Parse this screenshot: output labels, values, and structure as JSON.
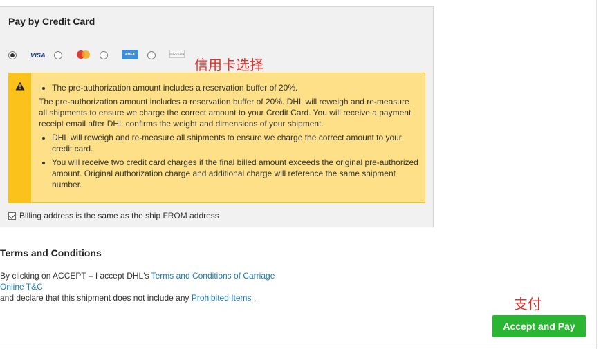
{
  "panel": {
    "title": "Pay by Credit Card",
    "cards": [
      {
        "name": "VISA",
        "selected": true
      },
      {
        "name": "MasterCard",
        "selected": false
      },
      {
        "name": "AMERICAN EXPRESS",
        "selected": false
      },
      {
        "name": "DISCOVER",
        "selected": false
      }
    ]
  },
  "annotations": {
    "card_select": "信用卡选择",
    "pay": "支付"
  },
  "warning": {
    "bullet_1": "The pre-authorization amount includes a reservation buffer of 20%.",
    "paragraph": "The pre-authorization amount includes a reservation buffer of 20%. DHL will reweigh and re-measure all shipments to ensure we charge the correct amount to your Credit Card. You will receive a payment receipt email after DHL confirms the weight and dimensions of your shipment.",
    "bullet_2": "DHL will reweigh and re-measure all shipments to ensure we charge the correct amount to your credit card.",
    "bullet_3": "You will receive two credit card charges if the final billed amount exceeds the original pre-authorized amount. Original authorization charge and additional charge will reference the same shipment number."
  },
  "billing": {
    "label": "Billing address is the same as the ship FROM address",
    "checked": true
  },
  "terms": {
    "title": "Terms and Conditions",
    "line1_prefix": "By clicking on ACCEPT – I accept DHL's ",
    "line1_link": "Terms and Conditions of Carriage",
    "line2_link": "Online T&C",
    "line3_prefix": "and declare that this shipment does not include any ",
    "line3_link": "Prohibited Items",
    "line3_suffix": " ."
  },
  "actions": {
    "accept_label": "Accept and Pay"
  },
  "colors": {
    "accept_green": "#2ab532",
    "warning_bg": "#fde088",
    "warning_strip": "#fcc21c",
    "link_blue": "#1a7abf",
    "annotation_red": "#e0312b"
  }
}
